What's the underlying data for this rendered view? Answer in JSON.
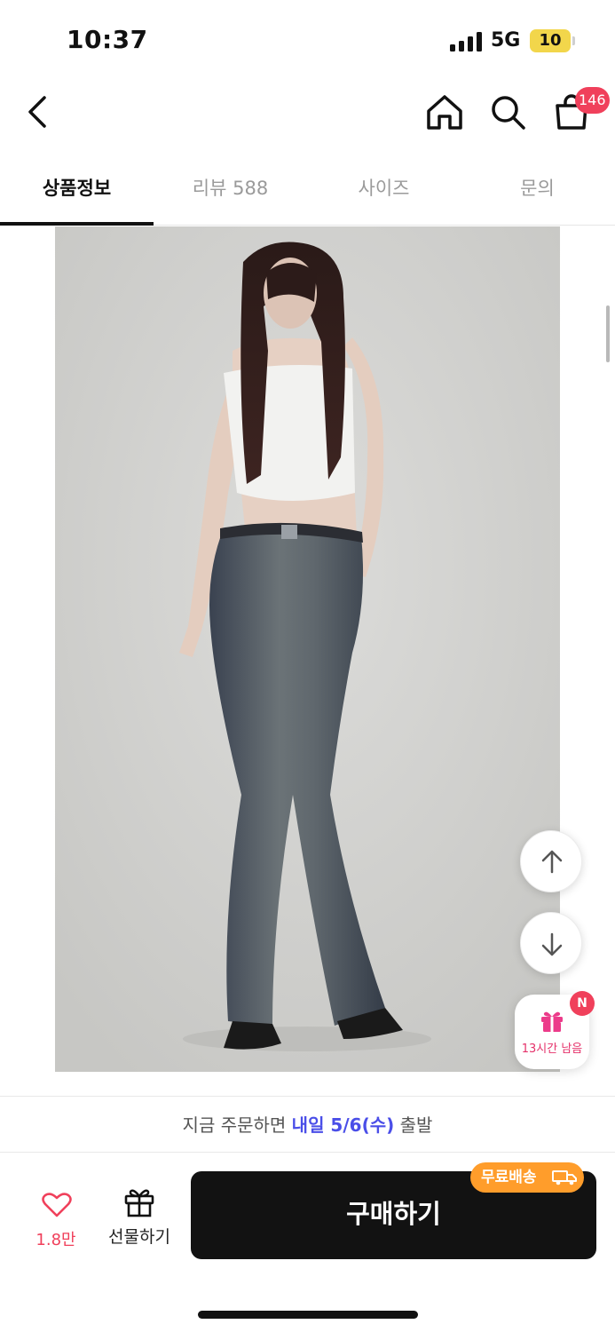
{
  "status_bar": {
    "time": "10:37",
    "network": "5G",
    "battery": "10"
  },
  "header": {
    "cart_count": "146"
  },
  "tabs": [
    {
      "label": "상품정보"
    },
    {
      "label": "리뷰 588"
    },
    {
      "label": "사이즈"
    },
    {
      "label": "문의"
    }
  ],
  "floating": {
    "gift_timer": "13시간 남음",
    "new_badge": "N"
  },
  "shipping": {
    "prefix": "지금 주문하면 ",
    "highlight": "내일 5/6(수)",
    "suffix": " 출발"
  },
  "actions": {
    "like_count": "1.8만",
    "gift_label": "선물하기",
    "buy_label": "구매하기",
    "free_shipping": "무료배송"
  }
}
